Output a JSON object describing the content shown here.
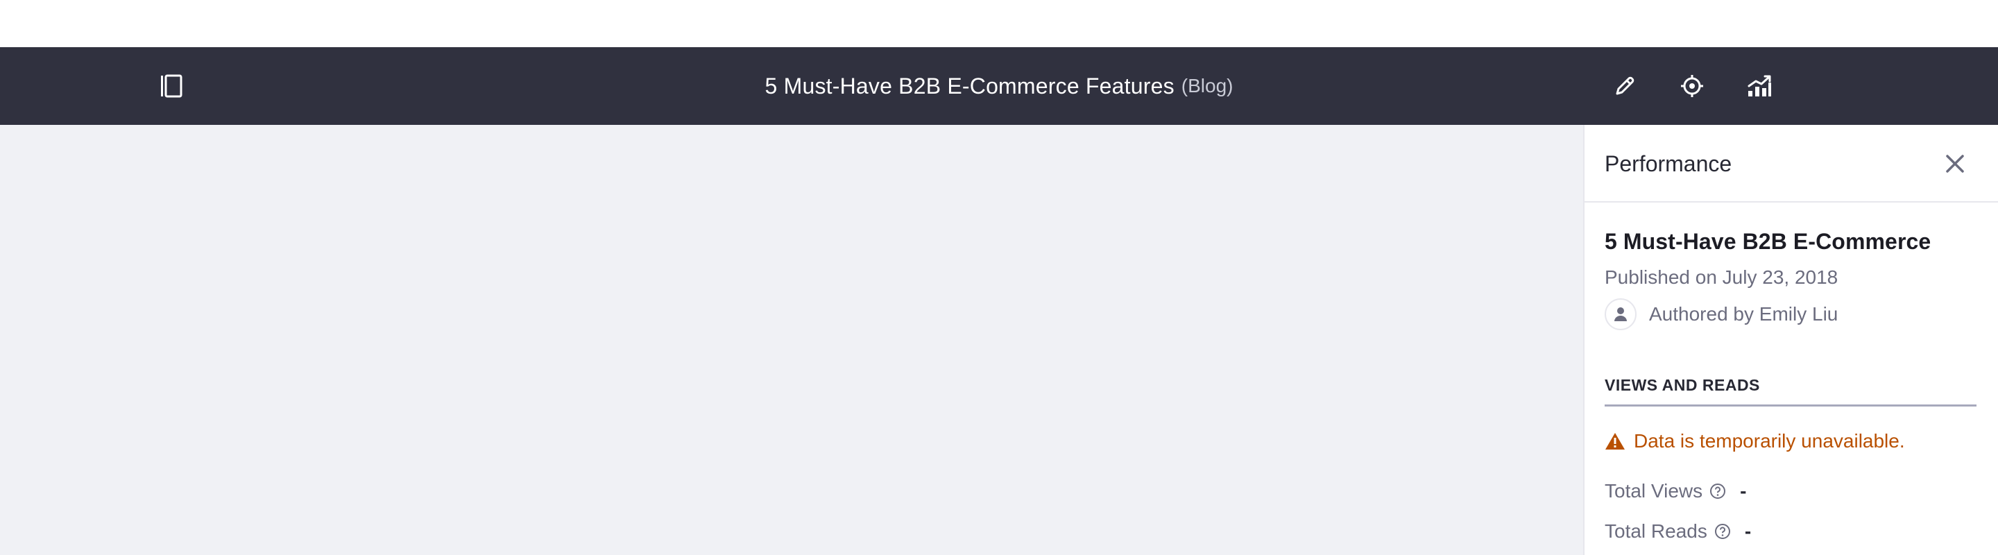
{
  "header": {
    "title": "5 Must-Have B2B E-Commerce Features",
    "subtitle": "(Blog)",
    "icons": [
      "sidebar-toggle-icon",
      "pencil-icon",
      "target-icon",
      "performance-chart-icon"
    ]
  },
  "panel": {
    "title": "Performance",
    "close_icon": "close-icon",
    "article_title": "5 Must-Have B2B E-Commerce",
    "published": "Published on July 23, 2018",
    "author": "Authored by Emily Liu",
    "section_heading": "VIEWS AND READS",
    "warning": "Data is temporarily unavailable.",
    "metrics": [
      {
        "label": "Total Views",
        "value": "-"
      },
      {
        "label": "Total Reads",
        "value": "-"
      }
    ]
  },
  "colors": {
    "topbar": "#30313f",
    "canvas": "#f0f1f5",
    "warning": "#b95000",
    "text_primary": "#272833",
    "text_secondary": "#6b6c7e"
  }
}
